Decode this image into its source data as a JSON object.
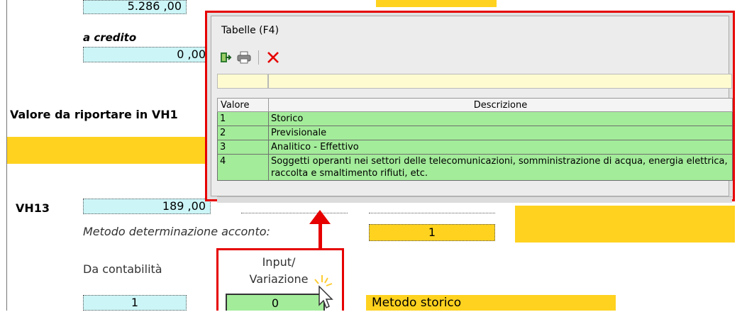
{
  "form": {
    "top_value": "5.286 ,00",
    "credito_label": "a credito",
    "credito_value": "0 ,00",
    "riportare_label": "Valore da riportare in VH1",
    "vh13_label": "VH13",
    "vh13_value": "189 ,00",
    "metodo_label": "Metodo determinazione acconto:",
    "metodo_value": "1",
    "contabilita_label": "Da contabilità",
    "contabilita_value": "1",
    "input_label_1": "Input/",
    "input_label_2": "Variazione",
    "input_value": "0",
    "metodo_storico_label": "Metodo storico"
  },
  "popup": {
    "title": "Tabelle (F4)",
    "toolbar": {
      "icons": [
        "exit-icon",
        "print-icon",
        "close-icon"
      ]
    },
    "columns": [
      "Valore",
      "Descrizione"
    ],
    "rows": [
      {
        "valore": "1",
        "descrizione": "Storico"
      },
      {
        "valore": "2",
        "descrizione": "Previsionale"
      },
      {
        "valore": "3",
        "descrizione": "Analitico - Effettivo"
      },
      {
        "valore": "4",
        "descrizione": "Soggetti operanti nei settori delle telecomunicazioni, somministrazione di acqua, energia elettrica, raccolta e smaltimento rifiuti, etc."
      }
    ]
  },
  "colors": {
    "highlight_red": "#e60000",
    "cyan_field": "#ccf5f7",
    "gold_field": "#ffd21f",
    "green_row": "#a3ec9a",
    "filter_yellow": "#fffbd1"
  }
}
